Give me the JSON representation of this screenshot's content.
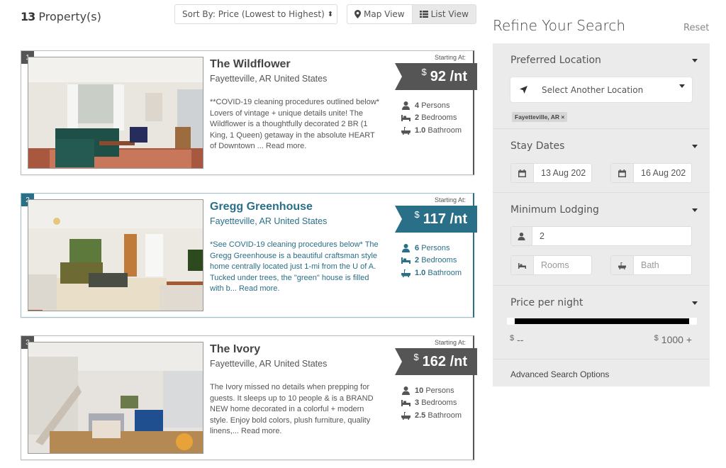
{
  "header": {
    "count": "13",
    "count_label": " Property(s)",
    "sort_label": "Sort By: Price (Lowest to Highest)",
    "sort_icon": "sort-caret-icon",
    "map_view": "Map View",
    "list_view": "List View",
    "active_view": "List View"
  },
  "listings": [
    {
      "index": "1",
      "name": "The Wildflower",
      "location": "Fayetteville, AR United States",
      "description": "**COVID-19 cleaning procedures outlined below* Lovers of vintage + unique details unite! The Wildflower is a thoughtfully decorated 2 BR (1 King, 1 Queen) getaway in the absolute HEART of Downtown ... Read more.",
      "starting_at": "Starting At:",
      "currency": "$",
      "price": "92 /nt",
      "persons": "4",
      "persons_label": "Persons",
      "bedrooms": "2",
      "bedrooms_label": "Bedrooms",
      "bathrooms": "1.0",
      "bathrooms_label": "Bathroom",
      "highlighted": false
    },
    {
      "index": "2",
      "name": "Gregg Greenhouse",
      "location": "Fayetteville, AR United States",
      "description": "*See COVID-19 cleaning procedures below* The Gregg Greenhouse is a beautiful craftsman style home centrally located just 1-mi from the U of A. Tucked under trees, the \"green\" house is filled with b... Read more.",
      "starting_at": "Starting At:",
      "currency": "$",
      "price": "117 /nt",
      "persons": "6",
      "persons_label": "Persons",
      "bedrooms": "2",
      "bedrooms_label": "Bedrooms",
      "bathrooms": "1.0",
      "bathrooms_label": "Bathroom",
      "highlighted": true
    },
    {
      "index": "3",
      "name": "The Ivory",
      "location": "Fayetteville, AR United States",
      "description": "The Ivory missed no details when prepping for guests. It sleeps up to 10 people & is a BRAND NEW home decorated in a colorful + modern style. Enjoy bold colors, plush furniture, quality linens,... Read more.",
      "starting_at": "Starting At:",
      "currency": "$",
      "price": "162 /nt",
      "persons": "10",
      "persons_label": "Persons",
      "bedrooms": "3",
      "bedrooms_label": "Bedrooms",
      "bathrooms": "2.5",
      "bathrooms_label": "Bathroom",
      "highlighted": false
    }
  ],
  "sidebar": {
    "title": "Refine Your Search",
    "reset": "Reset",
    "location": {
      "title": "Preferred Location",
      "select_placeholder": "Select Another Location",
      "chip": "Fayetteville, AR ×"
    },
    "dates": {
      "title": "Stay Dates",
      "checkin": "13 Aug 202",
      "checkout": "16 Aug 202"
    },
    "lodging": {
      "title": "Minimum Lodging",
      "guests": "2",
      "rooms_placeholder": "Rooms",
      "bath_placeholder": "Bath"
    },
    "price": {
      "title": "Price per night",
      "currency": "$",
      "min_label": "--",
      "max_label": "1000 +",
      "range_min_fraction": 0,
      "range_max_fraction": 1
    },
    "advanced": "Advanced Search Options"
  },
  "colors": {
    "accent": "#2a6f88",
    "neutral_ribbon": "#555555",
    "panel_bg": "#ebebeb"
  }
}
